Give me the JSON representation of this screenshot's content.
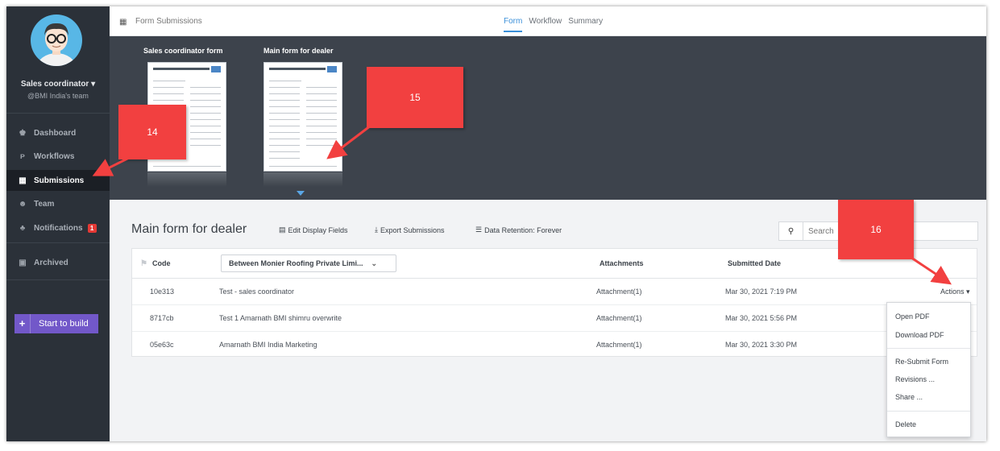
{
  "sidebar": {
    "user_name": "Sales coordinator",
    "user_team": "@BMI India's team",
    "items": [
      {
        "icon": "bank-icon",
        "label": "Dashboard"
      },
      {
        "icon": "workflow-icon",
        "label": "Workflows"
      },
      {
        "icon": "grid-icon",
        "label": "Submissions"
      },
      {
        "icon": "team-icon",
        "label": "Team"
      },
      {
        "icon": "bell-icon",
        "label": "Notifications",
        "badge": "1"
      },
      {
        "icon": "archive-icon",
        "label": "Archived"
      }
    ],
    "start_label": "Start to build"
  },
  "header": {
    "form_title": "Form Submissions",
    "tabs": [
      "Form",
      "Workflow",
      "Summary"
    ],
    "active_tab": "Form"
  },
  "previews": [
    {
      "title": "Sales coordinator form"
    },
    {
      "title": "Main form for dealer"
    }
  ],
  "content": {
    "title": "Main form for dealer",
    "edit_fields": "Edit Display Fields",
    "export": "Export Submissions",
    "retention": "Data Retention: Forever",
    "search_placeholder": "Search"
  },
  "table": {
    "headers": {
      "code": "Code",
      "column_select": "Between Monier Roofing Private Limi...",
      "attachments": "Attachments",
      "submitted": "Submitted Date"
    },
    "rows": [
      {
        "code": "10e313",
        "name": "Test - sales coordinator",
        "attachment": "Attachment(1)",
        "date": "Mar 30, 2021 7:19 PM",
        "actions": "Actions"
      },
      {
        "code": "8717cb",
        "name": "Test 1 Amarnath BMI shimru overwrite",
        "attachment": "Attachment(1)",
        "date": "Mar 30, 2021 5:56 PM"
      },
      {
        "code": "05e63c",
        "name": "Amarnath BMI India Marketing",
        "attachment": "Attachment(1)",
        "date": "Mar 30, 2021 3:30 PM"
      }
    ]
  },
  "actions_menu": [
    "Open PDF",
    "Download PDF",
    "Re-Submit Form",
    "Revisions ...",
    "Share ...",
    "Delete"
  ],
  "callouts": [
    "14",
    "15",
    "16"
  ],
  "colors": {
    "sidebar_bg": "#2b3139",
    "strip_bg": "#3d434c",
    "accent_blue": "#3a8fd9",
    "build_button": "#7258c9",
    "callout_red": "#f24040"
  }
}
